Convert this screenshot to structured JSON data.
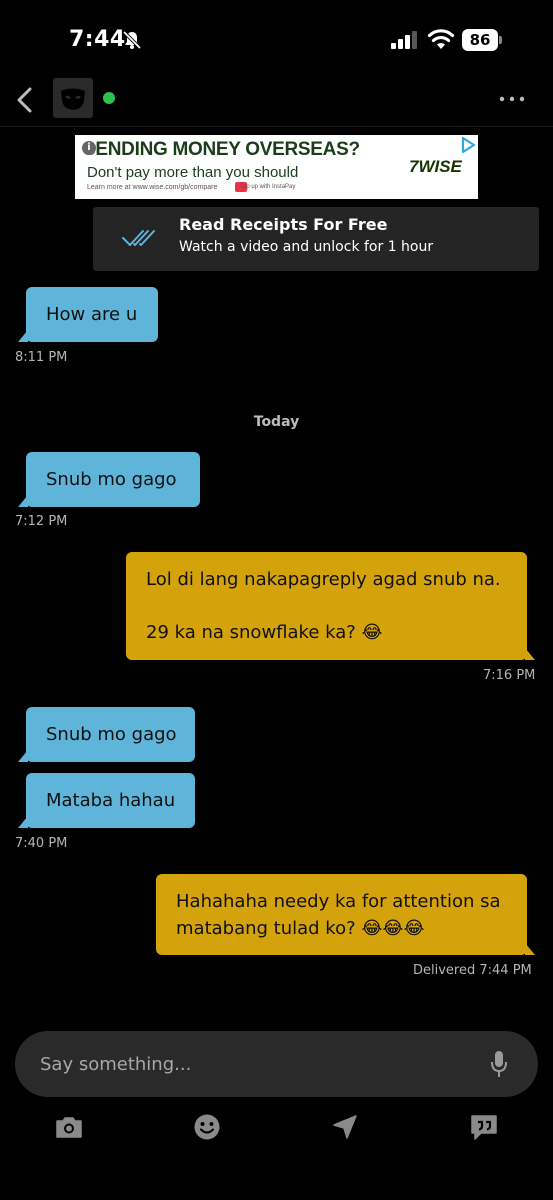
{
  "status_bar": {
    "time": "7:44",
    "battery": "86"
  },
  "header": {
    "online": true
  },
  "ad": {
    "info_glyph": "i",
    "headline": "SENDING MONEY OVERSEAS?",
    "subline": "Don't pay more than you should",
    "fine_print": "Learn more at www.wise.com/gb/compare",
    "fine_print_2": "Tap up with InstaPay",
    "logo": "7WISE"
  },
  "promo": {
    "title": "Read Receipts For Free",
    "subtitle": "Watch a video and unlock for 1 hour"
  },
  "messages": {
    "m1": {
      "text": "How are u",
      "time": "8:11 PM"
    },
    "date_divider": "Today",
    "m2": {
      "text": "Snub mo gago",
      "time": "7:12 PM"
    },
    "m3": {
      "line1": "Lol di lang nakapagreply agad snub na.",
      "line2": "29 ka na snowflake ka? 😂",
      "time": "7:16 PM"
    },
    "m4": {
      "text": "Snub mo gago"
    },
    "m5": {
      "text": "Mataba hahau",
      "time": "7:40 PM"
    },
    "m6": {
      "line1": "Hahahaha needy ka for attention sa",
      "line2": "matabang tulad ko? 😂😂😂",
      "status": "Delivered 7:44 PM"
    }
  },
  "composer": {
    "placeholder": "Say something..."
  },
  "toolbar": {
    "icons": [
      "camera-icon",
      "smiley-icon",
      "location-arrow-icon",
      "quick-replies-icon"
    ]
  },
  "colors": {
    "incoming_bubble": "#5fb4d9",
    "outgoing_bubble": "#d4a20a",
    "online_dot": "#2ec24a",
    "background": "#000000"
  }
}
